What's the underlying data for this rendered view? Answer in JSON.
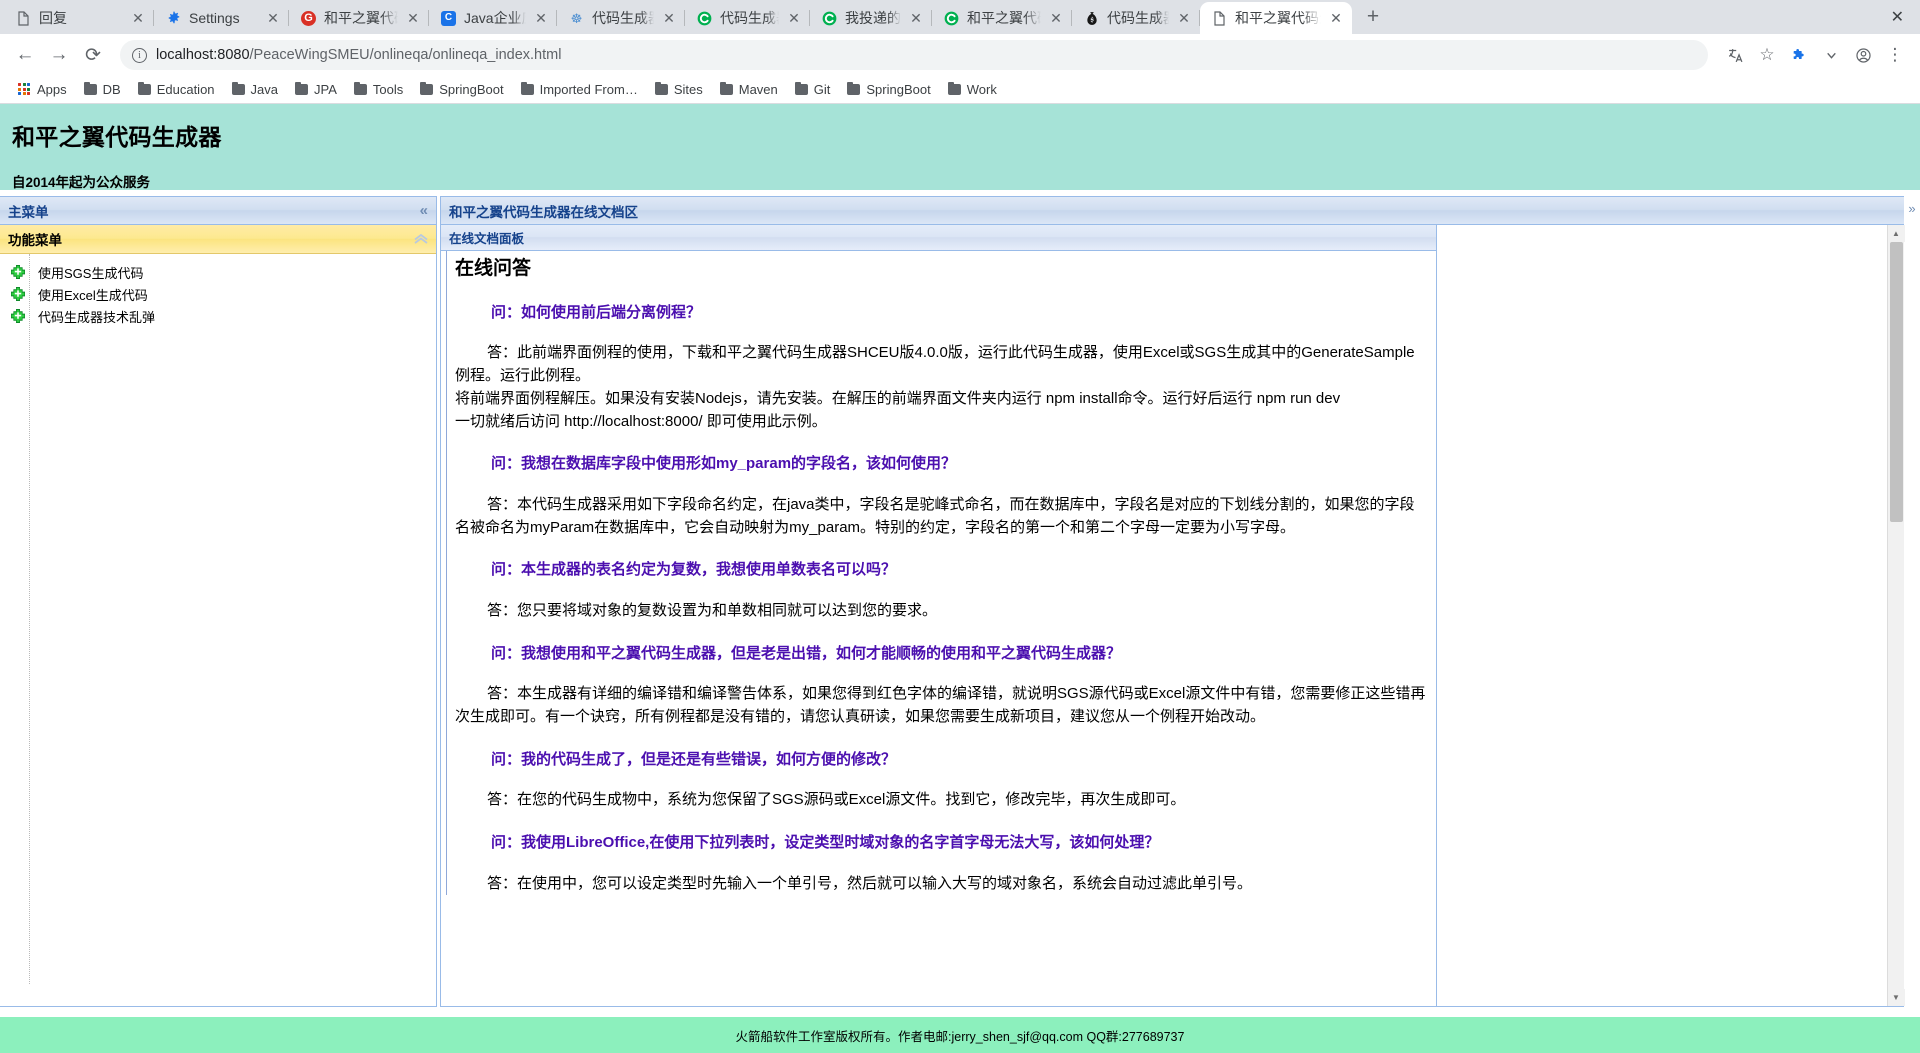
{
  "browser": {
    "tabs": [
      {
        "title": "回复",
        "icon": "document-icon",
        "icon_kind": "doc",
        "active": false
      },
      {
        "title": "Settings",
        "icon": "gear-icon",
        "icon_kind": "gear",
        "active": false
      },
      {
        "title": "和平之翼代码生成",
        "icon": "g-circle-icon",
        "icon_kind": "g",
        "active": false
      },
      {
        "title": "Java企业应用论坛",
        "icon": "forum-icon",
        "icon_kind": "blue",
        "active": false
      },
      {
        "title": "代码生成器技术乱弹",
        "icon": "csdn-icon",
        "icon_kind": "csdn",
        "active": false
      },
      {
        "title": "代码生成器 - MSD",
        "icon": "c-circle-icon",
        "icon_kind": "green",
        "active": false
      },
      {
        "title": "我投递的新闻 - M",
        "icon": "c-circle-icon",
        "icon_kind": "green",
        "active": false
      },
      {
        "title": "和平之翼代码生成",
        "icon": "c-circle-icon",
        "icon_kind": "green",
        "active": false
      },
      {
        "title": "代码生成器技术乱",
        "icon": "moneybag-icon",
        "icon_kind": "money",
        "active": false
      },
      {
        "title": "和平之翼代码生成",
        "icon": "document-icon",
        "icon_kind": "doc",
        "active": true
      }
    ],
    "tab_close_label": "✕",
    "new_tab_label": "+",
    "window_close_label": "✕",
    "nav": {
      "back": "←",
      "forward": "→",
      "reload": "⟳",
      "url_host": "localhost:8080",
      "url_path": "/PeaceWingSMEU/onlineqa/onlineqa_index.html",
      "info_icon_label": "i",
      "translate": "translate-icon",
      "bookmark_star": "☆",
      "extension": "extension-icon",
      "profile": "profile-icon",
      "menu": "⋮"
    },
    "bookmarks": [
      {
        "label": "Apps",
        "kind": "apps"
      },
      {
        "label": "DB",
        "kind": "folder"
      },
      {
        "label": "Education",
        "kind": "folder"
      },
      {
        "label": "Java",
        "kind": "folder"
      },
      {
        "label": "JPA",
        "kind": "folder"
      },
      {
        "label": "Tools",
        "kind": "folder"
      },
      {
        "label": "SpringBoot",
        "kind": "folder"
      },
      {
        "label": "Imported From…",
        "kind": "folder"
      },
      {
        "label": "Sites",
        "kind": "folder"
      },
      {
        "label": "Maven",
        "kind": "folder"
      },
      {
        "label": "Git",
        "kind": "folder"
      },
      {
        "label": "SpringBoot",
        "kind": "folder"
      },
      {
        "label": "Work",
        "kind": "folder"
      }
    ]
  },
  "page": {
    "header": {
      "title": "和平之翼代码生成器",
      "subtitle": "自2014年起为公众服务",
      "background_color": "#a6e3d7"
    },
    "west": {
      "panel_title": "主菜单",
      "collapse_icon": "«",
      "accordion_title": "功能菜单",
      "accordion_icon": "collapse-chevron-icon",
      "menu_items": [
        {
          "label": "使用SGS生成代码",
          "icon": "plus-node-icon"
        },
        {
          "label": "使用Excel生成代码",
          "icon": "plus-node-icon"
        },
        {
          "label": "代码生成器技术乱弹",
          "icon": "plus-node-icon"
        }
      ]
    },
    "center": {
      "panel_title": "和平之翼代码生成器在线文档区",
      "doc_panel_title": "在线文档面板",
      "collapse_icon": "»",
      "doc_title": "在线问答",
      "qa": [
        {
          "q": "问：如何使用前后端分离例程？",
          "a_lines": [
            "答：此前端界面例程的使用，下载和平之翼代码生成器SHCEU版4.0.0版，运行此代码生成器，使用Excel或SGS生成其中的GenerateSample例程。运行此例程。",
            "将前端界面例程解压。如果没有安装Nodejs，请先安装。在解压的前端界面文件夹内运行 npm install命令。运行好后运行 npm run dev",
            "一切就绪后访问 http://localhost:8000/ 即可使用此示例。"
          ]
        },
        {
          "q": "问：我想在数据库字段中使用形如my_param的字段名，该如何使用？",
          "a_lines": [
            "答：本代码生成器采用如下字段命名约定，在java类中，字段名是驼峰式命名，而在数据库中，字段名是对应的下划线分割的，如果您的字段名被命名为myParam在数据库中，它会自动映射为my_param。特别的约定，字段名的第一个和第二个字母一定要为小写字母。"
          ]
        },
        {
          "q": "问：本生成器的表名约定为复数，我想使用单数表名可以吗？",
          "a_lines": [
            "答：您只要将域对象的复数设置为和单数相同就可以达到您的要求。"
          ]
        },
        {
          "q": "问：我想使用和平之翼代码生成器，但是老是出错，如何才能顺畅的使用和平之翼代码生成器？",
          "a_lines": [
            "答：本生成器有详细的编译错和编译警告体系，如果您得到红色字体的编译错，就说明SGS源代码或Excel源文件中有错，您需要修正这些错再次生成即可。有一个诀窍，所有例程都是没有错的，请您认真研读，如果您需要生成新项目，建议您从一个例程开始改动。"
          ]
        },
        {
          "q": "问：我的代码生成了，但是还是有些错误，如何方便的修改？",
          "a_lines": [
            "答：在您的代码生成物中，系统为您保留了SGS源码或Excel源文件。找到它，修改完毕，再次生成即可。"
          ]
        },
        {
          "q": "问：我使用LibreOffice,在使用下拉列表时，设定类型时域对象的名字首字母无法大写，该如何处理？",
          "a_lines": [
            "答：在使用中，您可以设定类型时先输入一个单引号，然后就可以输入大写的域对象名，系统会自动过滤此单引号。"
          ]
        }
      ],
      "scrollbar": {
        "up_arrow": "▲",
        "down_arrow": "▼"
      }
    },
    "footer": {
      "text": "火箭船软件工作室版权所有。作者电邮:jerry_shen_sjf@qq.com QQ群:277689737",
      "background_color": "#8cf0bd"
    }
  }
}
